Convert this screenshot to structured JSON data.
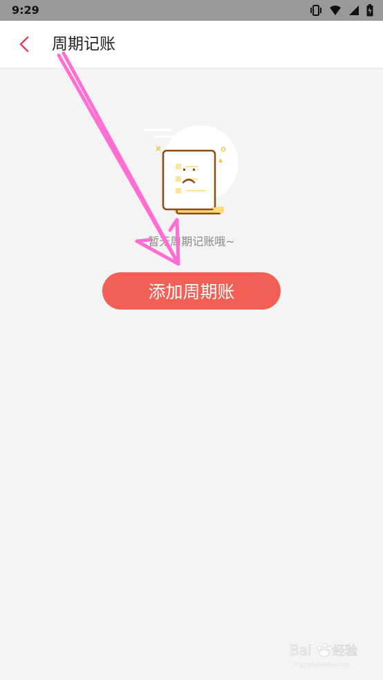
{
  "status_bar": {
    "time": "9:29"
  },
  "header": {
    "title": "周期记账"
  },
  "empty_state": {
    "message": "暂无周期记账哦~"
  },
  "actions": {
    "add_label": "添加周期账"
  },
  "colors": {
    "accent": "#f25f55",
    "back_icon": "#e0445a",
    "annotation_arrow": "#ff6ed2"
  },
  "watermark": {
    "text": "Baidu经验",
    "subtext": "jingyan.baidu.com"
  }
}
